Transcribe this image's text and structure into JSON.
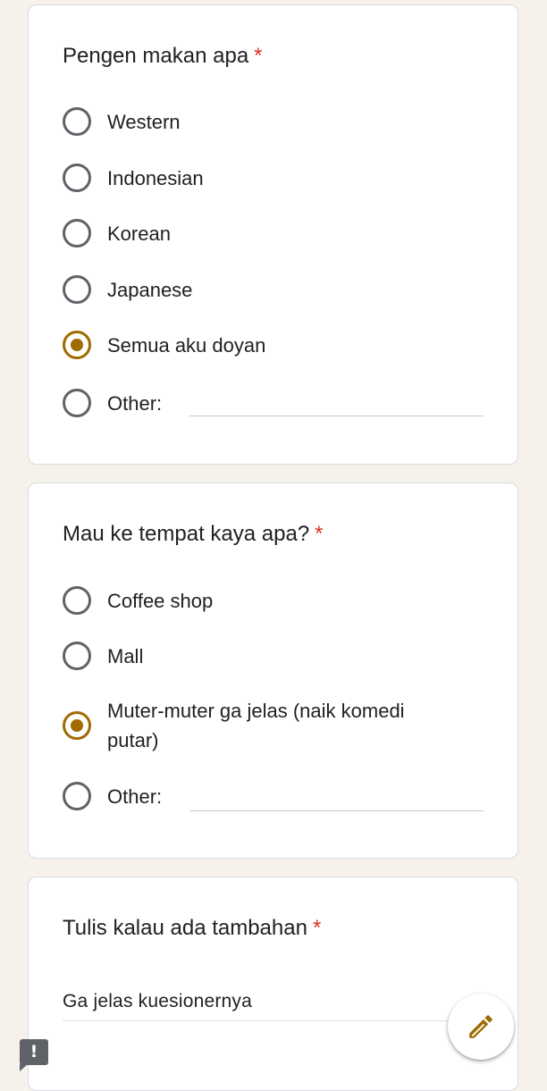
{
  "colors": {
    "background": "#f6f1ea",
    "card": "#ffffff",
    "accent": "#a06b00",
    "required": "#d93025",
    "radio_unchecked": "#5f6368"
  },
  "questions": [
    {
      "title": "Pengen makan apa",
      "required_mark": "*",
      "options": [
        {
          "label": "Western",
          "checked": false
        },
        {
          "label": "Indonesian",
          "checked": false
        },
        {
          "label": "Korean",
          "checked": false
        },
        {
          "label": "Japanese",
          "checked": false
        },
        {
          "label": "Semua aku doyan",
          "checked": true
        },
        {
          "label": "Other:",
          "checked": false
        }
      ]
    },
    {
      "title": "Mau ke tempat kaya apa?",
      "required_mark": "*",
      "options": [
        {
          "label": "Coffee shop",
          "checked": false
        },
        {
          "label": "Mall",
          "checked": false
        },
        {
          "label": "Muter-muter ga jelas (naik komedi putar)",
          "checked": true
        },
        {
          "label": "Other:",
          "checked": false
        }
      ]
    },
    {
      "title": "Tulis kalau ada tambahan",
      "required_mark": "*",
      "answer": "Ga jelas kuesionernya"
    }
  ],
  "icons": {
    "edit": "pencil-icon",
    "report": "exclamation-icon",
    "report_glyph": "!"
  }
}
